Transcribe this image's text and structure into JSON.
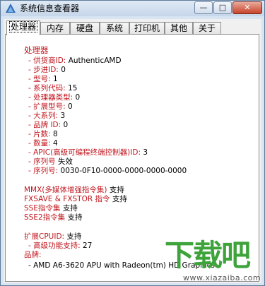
{
  "window": {
    "title": "系统信息查看器",
    "controls": {
      "minimize": "—",
      "maximize": "□",
      "close": "✕"
    }
  },
  "tabs": [
    "处理器",
    "内存",
    "硬盘",
    "系统",
    "打印机",
    "其他",
    "关于"
  ],
  "active_tab": "处理器",
  "processor": {
    "heading": "处理器",
    "fields": [
      {
        "label": "- 供货商ID: ",
        "value": "AuthenticAMD"
      },
      {
        "label": "- 步进ID: ",
        "value": "0"
      },
      {
        "label": "- 型号: ",
        "value": "1"
      },
      {
        "label": "- 系列代码: ",
        "value": "15"
      },
      {
        "label": "- 处理器类型: ",
        "value": "0"
      },
      {
        "label": "- 扩展型号: ",
        "value": "0"
      },
      {
        "label": "- 大系列: ",
        "value": "3"
      },
      {
        "label": "- 品牌 ID: ",
        "value": "0"
      },
      {
        "label": "- 片数: ",
        "value": "8"
      },
      {
        "label": "- 数量: ",
        "value": "4"
      },
      {
        "label": "- APIC(高级可编程终端控制器)ID: ",
        "value": "3"
      },
      {
        "label": "- 序列号 ",
        "value": "失效"
      },
      {
        "label": "- 序列号: ",
        "value": "0030-0F10-0000-0000-0000-0000"
      }
    ],
    "features": [
      {
        "label": "MMX(多媒体增强指令集) ",
        "value": "支持"
      },
      {
        "label": "FXSAVE & FXSTOR 指令 ",
        "value": "支持"
      },
      {
        "label": "SSE指令集 ",
        "value": "支持"
      },
      {
        "label": "SSE2指令集 ",
        "value": "支持"
      }
    ],
    "extended": {
      "label": "扩展CPUID: ",
      "value": "支持"
    },
    "extended_sub": {
      "label": "- 高级功能支持: ",
      "value": "27"
    },
    "brand_heading": "品牌:",
    "brand_value": "- AMD A6-3620 APU with Radeon(tm) HD Graphics"
  },
  "watermark": {
    "logo_text": "下载吧",
    "site": "www.xiazaiba.com"
  },
  "colors": {
    "label": "#c0171f",
    "value": "#000000",
    "logo": "#3da33a"
  }
}
